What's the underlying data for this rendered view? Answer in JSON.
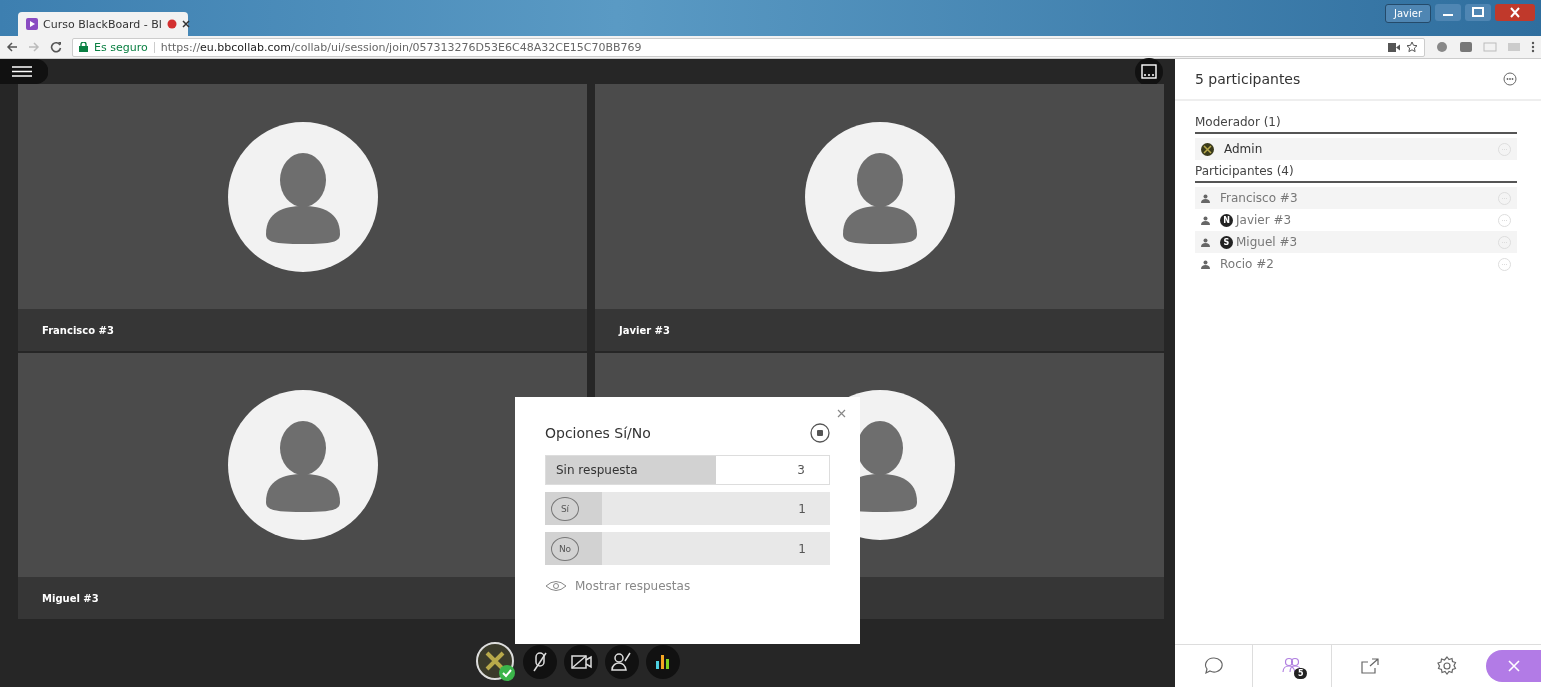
{
  "browser": {
    "tab_title": "Curso BlackBoard - Bl",
    "user": "Javier",
    "secure_label": "Es seguro",
    "url": "https://**eu.bbcollab.com**/collab/ui/session/join/057313276D53E6C48A32CE15C70BB769"
  },
  "tiles": [
    {
      "kind": "named",
      "name": "Francisco #3"
    },
    {
      "kind": "named",
      "name": "Javier #3"
    },
    {
      "kind": "named",
      "name": "Miguel #3"
    },
    {
      "kind": "covered"
    }
  ],
  "poll": {
    "title": "Opciones Sí/No",
    "options": [
      {
        "kind": "none",
        "label": "Sin respuesta",
        "count": "3",
        "level": 0.6
      },
      {
        "kind": "answer",
        "label": "Sí",
        "count": "1",
        "level": 0.2
      },
      {
        "kind": "answer",
        "label": "No",
        "count": "1",
        "level": 0.2
      }
    ],
    "show_responses": "Mostrar respuestas"
  },
  "panel": {
    "title": "5 participantes",
    "groups": [
      {
        "title": "Moderador (1)",
        "members": [
          {
            "kind": "moderator",
            "name": "Admin"
          }
        ]
      },
      {
        "title": "Participantes (4)",
        "members": [
          {
            "kind": "participant",
            "name": "Francisco #3"
          },
          {
            "kind": "participant",
            "name": "Javier #3",
            "badge": "N"
          },
          {
            "kind": "participant",
            "name": "Miguel #3",
            "badge": "S"
          },
          {
            "kind": "participant",
            "name": "Rocio #2"
          }
        ]
      }
    ]
  },
  "panel_tabs": [
    {
      "kind": "chat",
      "selected": false
    },
    {
      "kind": "participants",
      "selected": true,
      "badge": "5"
    },
    {
      "kind": "share",
      "selected": false
    },
    {
      "kind": "settings",
      "selected": false
    },
    {
      "kind": "close",
      "selected": false
    }
  ]
}
